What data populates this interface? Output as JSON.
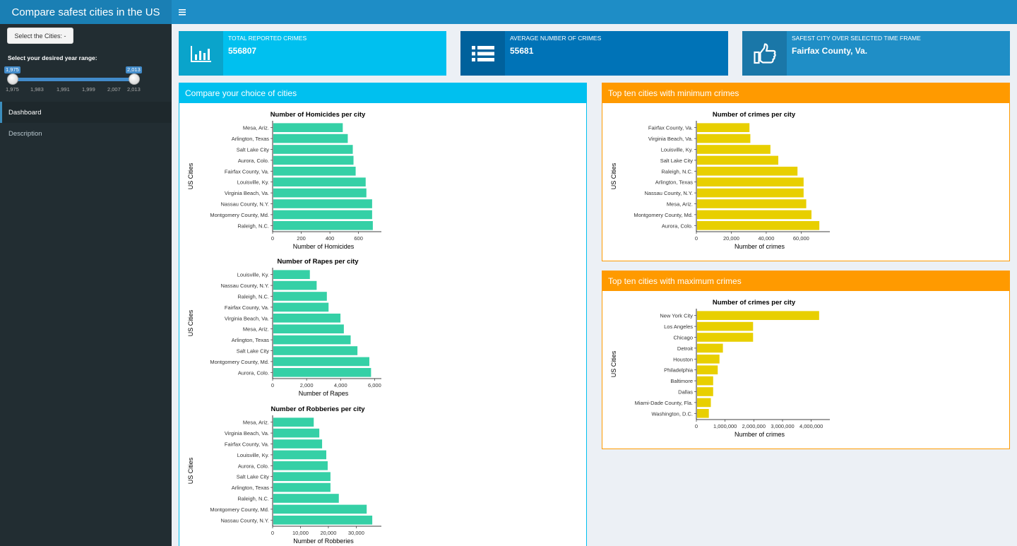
{
  "app_title": "Compare safest cities in the US",
  "header": {
    "toggle_icon": "hamburger-icon"
  },
  "sidebar": {
    "select_cities_label": "Select the Cities: -",
    "year_range_label": "Select your desired year range:",
    "slider": {
      "from": "1,975",
      "to": "2,013",
      "ticks": [
        "1,975",
        "1,983",
        "1,991",
        "1,999",
        "2,007",
        "2,013"
      ]
    },
    "menu": [
      {
        "label": "Dashboard",
        "active": true
      },
      {
        "label": "Description",
        "active": false
      }
    ]
  },
  "info_boxes": [
    {
      "label": "TOTAL REPORTED CRIMES",
      "value": "556807",
      "icon": "bar-chart-icon",
      "color": "#00c0ef",
      "icon_bg": "#0aa4cb"
    },
    {
      "label": "AVERAGE NUMBER OF CRIMES",
      "value": "55681",
      "icon": "list-icon",
      "color": "#0073b7",
      "icon_bg": "#00619c"
    },
    {
      "label": "SAFEST CITY OVER SELECTED TIME FRAME",
      "value": "Fairfax County, Va.",
      "icon": "thumbs-up-icon",
      "color": "#1f8ec6",
      "icon_bg": "#1a77a8"
    }
  ],
  "boxes": {
    "compare": {
      "title": "Compare your choice of cities",
      "color": "#00c0ef"
    },
    "min": {
      "title": "Top ten cities with minimum crimes",
      "color": "#ff9a00"
    },
    "max": {
      "title": "Top ten cities with maximum crimes",
      "color": "#ff9a00"
    }
  },
  "chart_data": [
    {
      "id": "homicides",
      "type": "bar",
      "orientation": "horizontal",
      "title": "Number of Homicides per city",
      "xlabel": "Number of Homicides",
      "ylabel": "US Cities",
      "categories": [
        "Mesa, Ariz.",
        "Arlington, Texas",
        "Salt Lake City",
        "Aurora, Colo.",
        "Fairfax County, Va.",
        "Louisville, Ky.",
        "Virginia Beach, Va.",
        "Nassau County, N.Y.",
        "Montgomery County, Md.",
        "Raleigh, N.C."
      ],
      "values": [
        485,
        520,
        555,
        560,
        575,
        645,
        650,
        690,
        690,
        695
      ],
      "xlim": [
        0,
        730
      ],
      "xticks": [
        0,
        200,
        400,
        600
      ],
      "xtick_labels": [
        "0",
        "200",
        "400",
        "600"
      ],
      "color": "#35d0a6"
    },
    {
      "id": "rapes",
      "type": "bar",
      "orientation": "horizontal",
      "title": "Number of Rapes per city",
      "xlabel": "Number of Rapes",
      "ylabel": "US Cities",
      "categories": [
        "Louisville, Ky.",
        "Nassau County, N.Y.",
        "Raleigh, N.C.",
        "Fairfax County, Va.",
        "Virginia Beach, Va.",
        "Mesa, Ariz.",
        "Arlington, Texas",
        "Salt Lake City",
        "Montgomery County, Md.",
        "Aurora, Colo."
      ],
      "values": [
        2150,
        2550,
        3150,
        3250,
        3950,
        4150,
        4550,
        4950,
        5650,
        5750
      ],
      "xlim": [
        0,
        6150
      ],
      "xticks": [
        0,
        2000,
        4000,
        6000
      ],
      "xtick_labels": [
        "0",
        "2,000",
        "4,000",
        "6,000"
      ],
      "color": "#35d0a6"
    },
    {
      "id": "robberies",
      "type": "bar",
      "orientation": "horizontal",
      "title": "Number of Robberies per city",
      "xlabel": "Number of Robberies",
      "ylabel": "US Cities",
      "categories": [
        "Mesa, Ariz.",
        "Virginia Beach, Va.",
        "Fairfax County, Va.",
        "Louisville, Ky.",
        "Aurora, Colo.",
        "Salt Lake City",
        "Arlington, Texas",
        "Raleigh, N.C.",
        "Montgomery County, Md.",
        "Nassau County, N.Y."
      ],
      "values": [
        14500,
        16500,
        17500,
        19000,
        19500,
        20500,
        20500,
        23500,
        33500,
        35500
      ],
      "xlim": [
        0,
        37500
      ],
      "xticks": [
        0,
        10000,
        20000,
        30000
      ],
      "xtick_labels": [
        "0",
        "10,000",
        "20,000",
        "30,000"
      ],
      "color": "#35d0a6"
    },
    {
      "id": "min_crimes",
      "type": "bar",
      "orientation": "horizontal",
      "title": "Number of crimes per city",
      "xlabel": "Number of crimes",
      "ylabel": "US Cities",
      "categories": [
        "Fairfax County, Va.",
        "Virginia Beach, Va.",
        "Louisville, Ky.",
        "Salt Lake City",
        "Raleigh, N.C.",
        "Arlington, Texas",
        "Nassau County, N.Y.",
        "Mesa, Ariz.",
        "Montgomery County, Md.",
        "Aurora, Colo."
      ],
      "values": [
        30000,
        30500,
        42000,
        46500,
        57500,
        61000,
        61000,
        62500,
        65500,
        70000
      ],
      "xlim": [
        0,
        74000
      ],
      "xticks": [
        0,
        20000,
        40000,
        60000
      ],
      "xtick_labels": [
        "0",
        "20,000",
        "40,000",
        "60,000"
      ],
      "color": "#e8cf00"
    },
    {
      "id": "max_crimes",
      "type": "bar",
      "orientation": "horizontal",
      "title": "Number of crimes per city",
      "xlabel": "Number of crimes",
      "ylabel": "US Cities",
      "categories": [
        "New York City",
        "Los Angeles",
        "Chicago",
        "Detroit",
        "Houston",
        "Philadelphia",
        "Baltimore",
        "Dallas",
        "Miami-Dade County, Fla.",
        "Washington, D.C."
      ],
      "values": [
        4250000,
        1950000,
        1950000,
        900000,
        780000,
        720000,
        560000,
        560000,
        480000,
        410000
      ],
      "xlim": [
        0,
        4500000
      ],
      "xticks": [
        0,
        1000000,
        2000000,
        3000000,
        4000000
      ],
      "xtick_labels": [
        "0",
        "1,000,000",
        "2,000,000",
        "3,000,000",
        "4,000,000"
      ],
      "color": "#e8cf00"
    }
  ]
}
